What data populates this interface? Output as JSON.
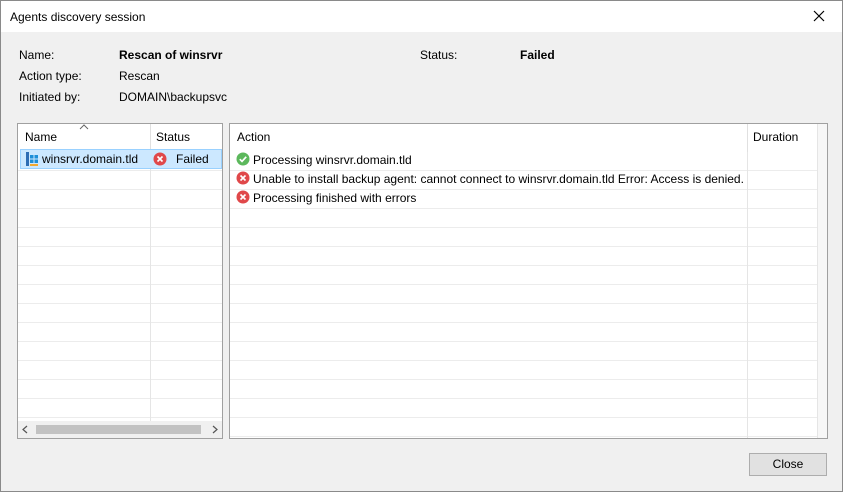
{
  "window": {
    "title": "Agents discovery session"
  },
  "info": {
    "name_label": "Name:",
    "name_value": "Rescan of winsrvr",
    "action_type_label": "Action type:",
    "action_type_value": "Rescan",
    "initiated_by_label": "Initiated by:",
    "initiated_by_value": "DOMAIN\\backupsvc",
    "status_label": "Status:",
    "status_value": "Failed"
  },
  "hosts": {
    "columns": {
      "name": "Name",
      "status": "Status"
    },
    "rows": [
      {
        "name": "winsrvr.domain.tld",
        "status": "Failed",
        "status_icon": "error-icon",
        "host_icon": "server-icon"
      }
    ]
  },
  "log": {
    "columns": {
      "action": "Action",
      "duration": "Duration"
    },
    "rows": [
      {
        "icon": "success-icon",
        "text": "Processing winsrvr.domain.tld"
      },
      {
        "icon": "error-icon",
        "text": "Unable to install backup agent: cannot connect to winsrvr.domain.tld Error: Access is denied."
      },
      {
        "icon": "error-icon",
        "text": "Processing finished with errors"
      }
    ]
  },
  "buttons": {
    "close": "Close"
  },
  "colors": {
    "error": "#e0484a",
    "success": "#5cb85c",
    "selection": "#cce8ff"
  }
}
